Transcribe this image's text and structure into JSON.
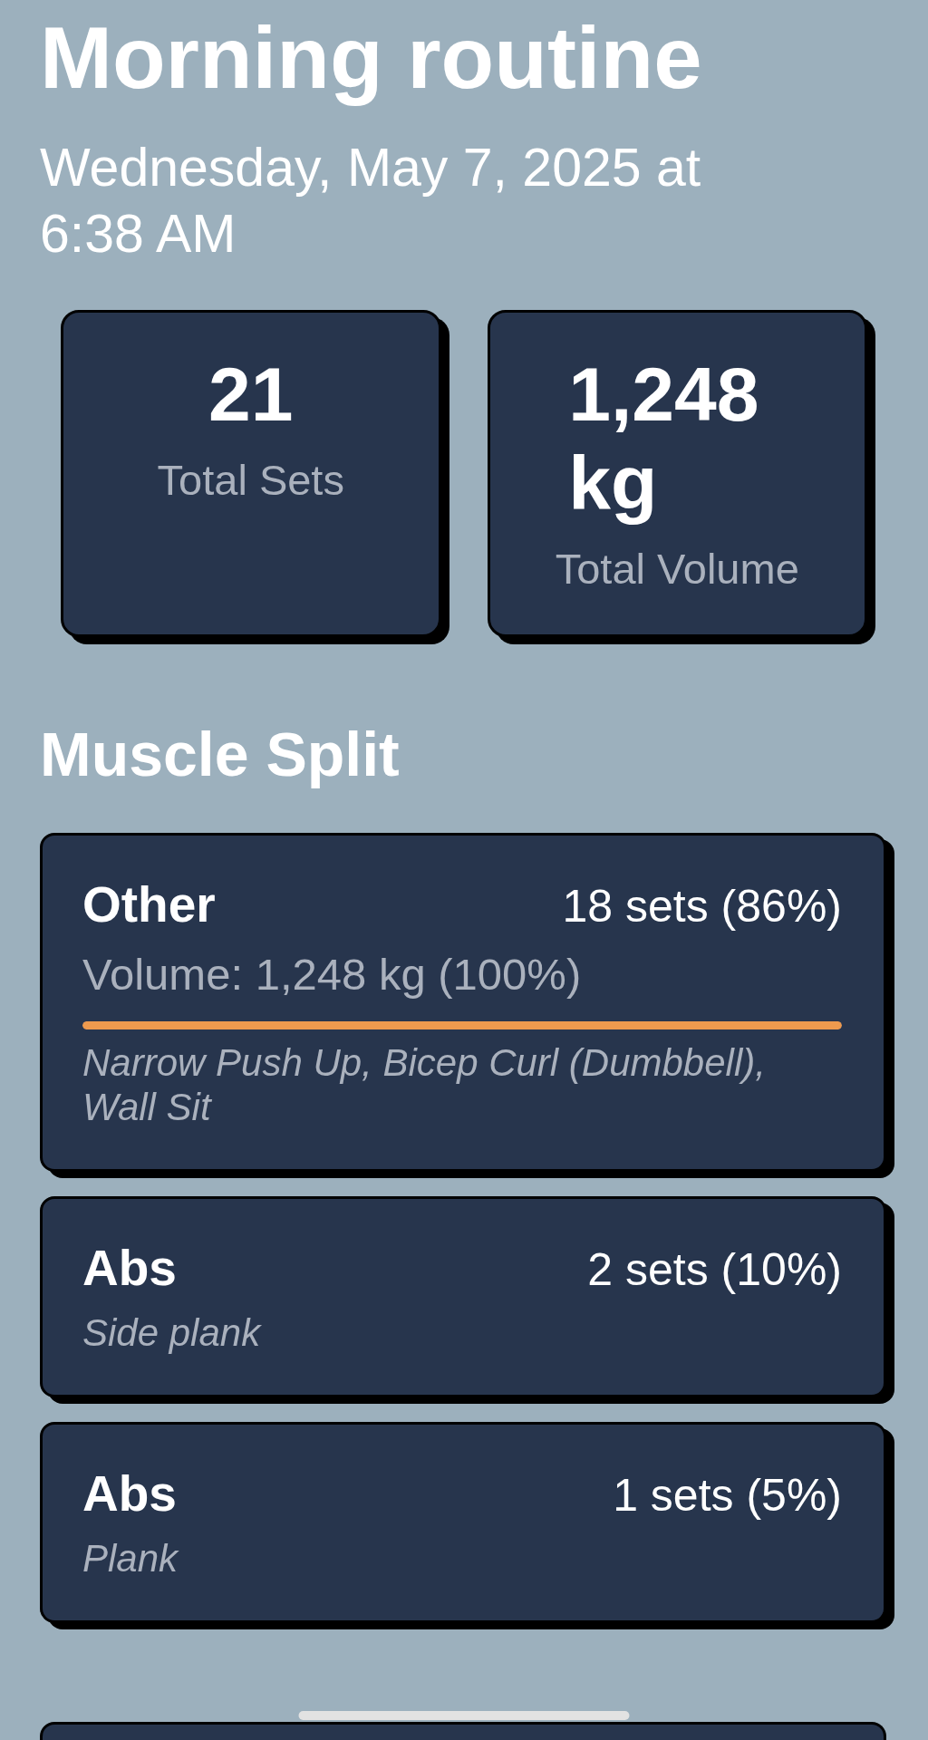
{
  "header": {
    "title": "Morning routine",
    "date": "Wednesday, May 7, 2025 at 6:38 AM"
  },
  "stats": [
    {
      "value": "21",
      "label": "Total Sets"
    },
    {
      "value": "1,248 kg",
      "label": "Total Volume"
    }
  ],
  "muscle_split": {
    "heading": "Muscle Split",
    "groups": [
      {
        "name": "Other",
        "sets": "18 sets (86%)",
        "volume": "Volume: 1,248 kg (100%)",
        "level": 1,
        "exercises": "Narrow Push Up, Bicep Curl (Dumbbell), Wall Sit"
      },
      {
        "name": "Abs",
        "sets": "2 sets (10%)",
        "exercises": "Side plank"
      },
      {
        "name": "Abs",
        "sets": "1 sets (5%)",
        "exercises": "Plank"
      }
    ]
  }
}
